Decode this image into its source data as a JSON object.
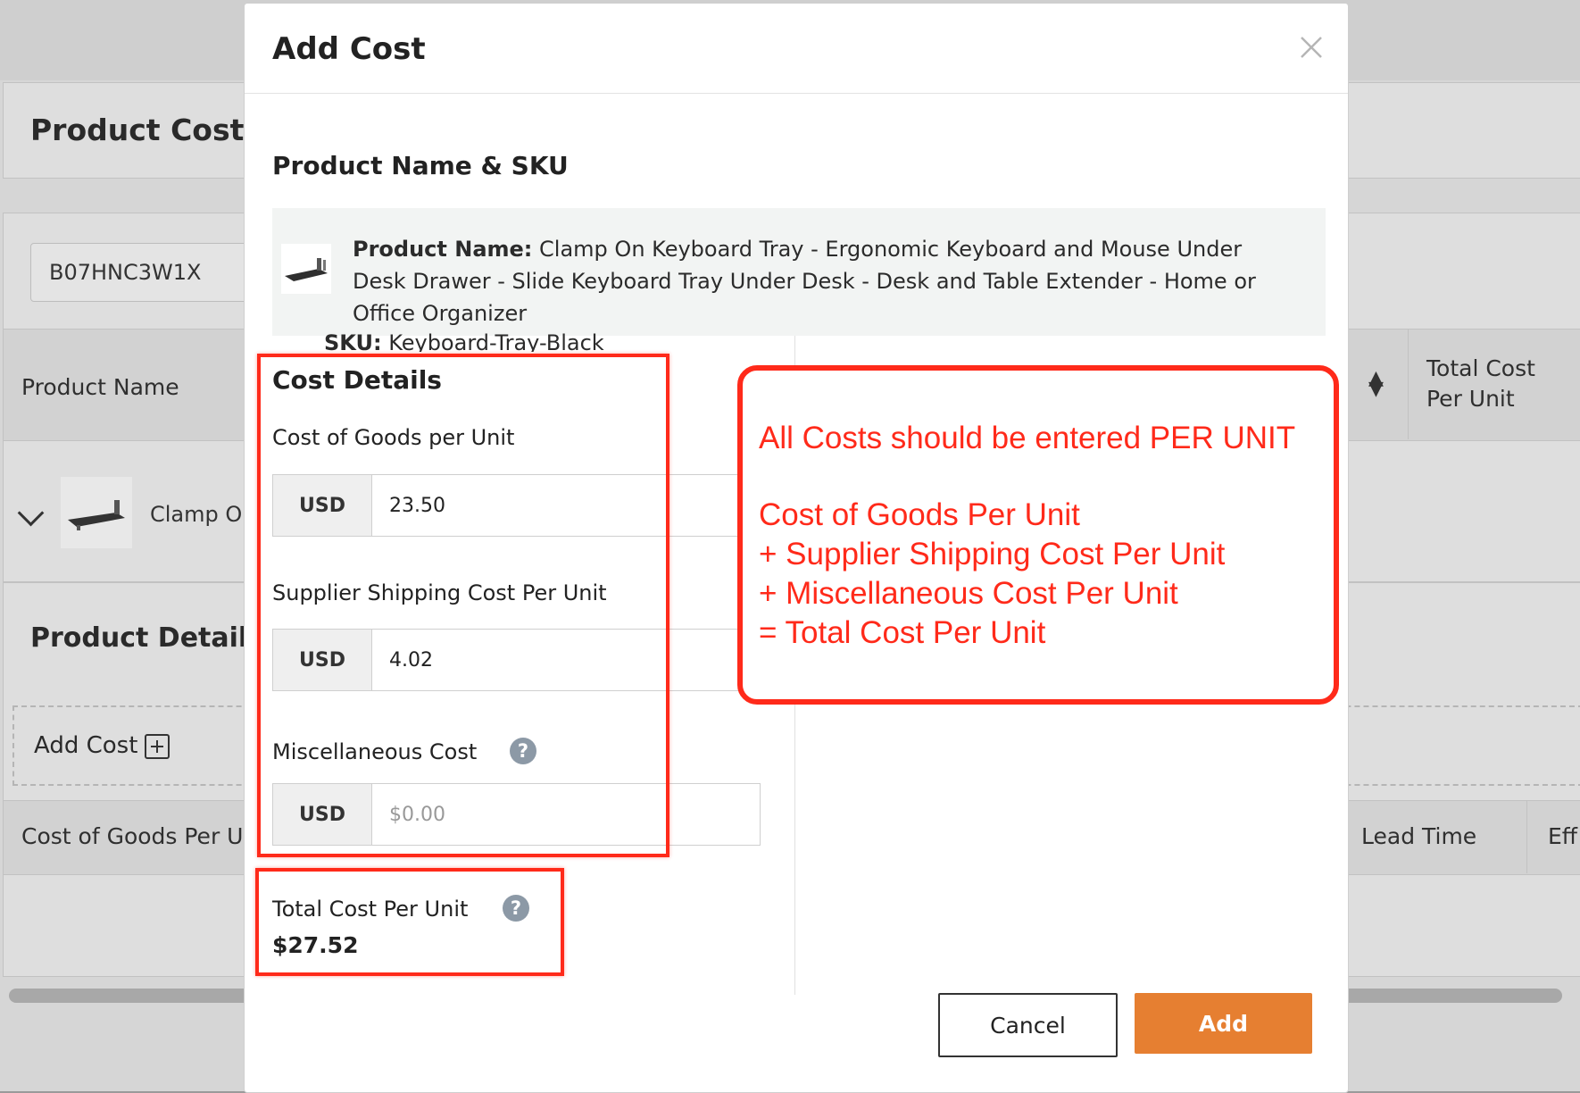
{
  "background": {
    "product_costs_heading": "Product Costs",
    "search_value": "B07HNC3W1X",
    "table_headers": {
      "product_name": "Product Name",
      "total_cost_per_unit_line1": "Total Cost",
      "total_cost_per_unit_line2": "Per Unit"
    },
    "row_product_name": "Clamp On",
    "product_details_heading": "Product Details",
    "add_cost_label": "Add Cost",
    "cost_table_headers": {
      "cost_of_goods": "Cost of Goods Per U",
      "lead_time": "Lead Time",
      "effective": "Eff"
    }
  },
  "modal": {
    "title": "Add Cost",
    "product_section_title": "Product Name & SKU",
    "product_name_label": "Product Name:",
    "product_name_value": "Clamp On Keyboard Tray - Ergonomic Keyboard and Mouse Under Desk Drawer - Slide Keyboard Tray Under Desk - Desk and Table Extender - Home or Office Organizer",
    "sku_label": "SKU:",
    "sku_value": "Keyboard-Tray-Black",
    "cost_details_title": "Cost Details",
    "fields": {
      "cost_of_goods": {
        "label": "Cost of Goods per Unit",
        "currency": "USD",
        "value": "23.50"
      },
      "supplier_shipping": {
        "label": "Supplier Shipping Cost Per Unit",
        "currency": "USD",
        "value": "4.02"
      },
      "miscellaneous": {
        "label": "Miscellaneous Cost",
        "currency": "USD",
        "value": "",
        "placeholder": "$0.00"
      }
    },
    "total": {
      "label": "Total Cost Per Unit",
      "value": "$27.52"
    },
    "buttons": {
      "cancel": "Cancel",
      "add": "Add"
    }
  },
  "annotation": {
    "lines": [
      "All Costs should be entered PER UNIT",
      "Cost of Goods Per Unit",
      "+ Supplier Shipping Cost Per Unit",
      "+ Miscellaneous Cost Per Unit",
      "= Total Cost Per Unit"
    ]
  },
  "colors": {
    "accent": "#e67f31",
    "annotation_red": "#ff2a1a",
    "help_icon": "#8c99a6"
  }
}
